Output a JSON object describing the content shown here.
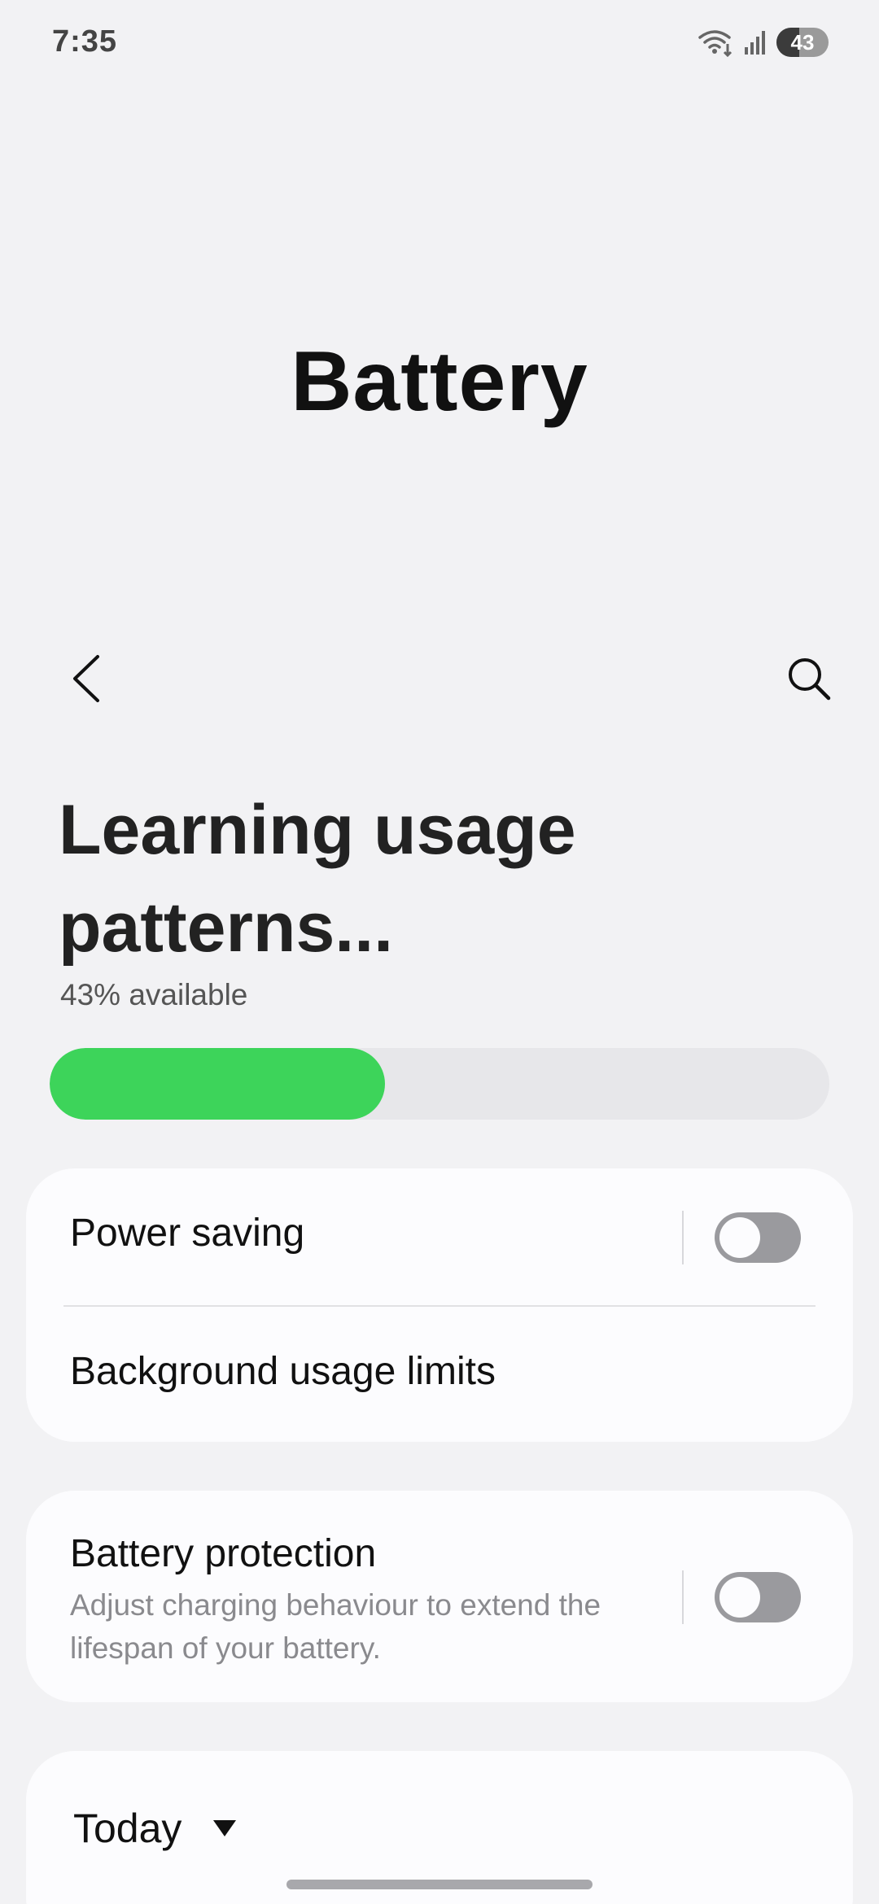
{
  "status_bar": {
    "time": "7:35",
    "battery_level": "43",
    "battery_fraction": 0.43,
    "icons": [
      "wifi-icon",
      "signal-icon",
      "battery-icon"
    ]
  },
  "header": {
    "title": "Battery",
    "back_icon": "chevron-left-icon",
    "search_icon": "search-icon"
  },
  "battery_status": {
    "headline": "Learning usage patterns...",
    "available_text": "43% available",
    "level_percent": 43,
    "bar_color": "#3dd45a"
  },
  "settings": {
    "power_saving": {
      "label": "Power saving",
      "enabled": false
    },
    "background_limits": {
      "label": "Background usage limits"
    },
    "battery_protection": {
      "label": "Battery protection",
      "description": "Adjust charging behaviour to extend the lifespan of your battery.",
      "enabled": false
    }
  },
  "usage": {
    "period_label": "Today",
    "dropdown_icon": "triangle-down-icon"
  }
}
